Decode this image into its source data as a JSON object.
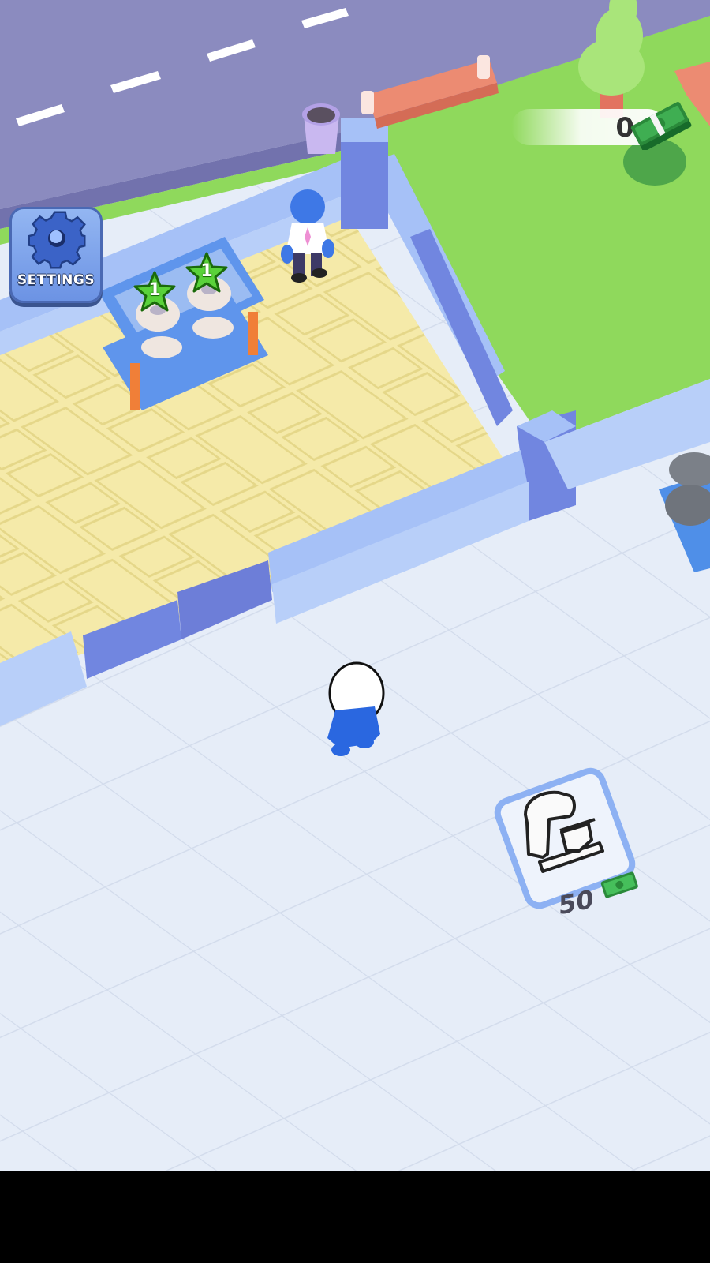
{
  "hud": {
    "money": "0",
    "money_icon": "cash-stack-icon",
    "settings_label": "SETTINGS",
    "settings_icon": "gear-icon"
  },
  "shelf": {
    "donut_counts": [
      "1",
      "1"
    ],
    "star_icon": "green-star-icon"
  },
  "build_spot": {
    "item_icon": "stand-mixer-icon",
    "price": "50",
    "currency_icon": "cash-icon"
  },
  "colors": {
    "road": "#8b8bbf",
    "grass": "#8fd95c",
    "bakery_floor": "#f5eaa9",
    "wall": "#a6c1f7",
    "wall_dark": "#7186e0",
    "tile_floor": "#e6edf8",
    "cash_green": "#2a8a3a"
  }
}
